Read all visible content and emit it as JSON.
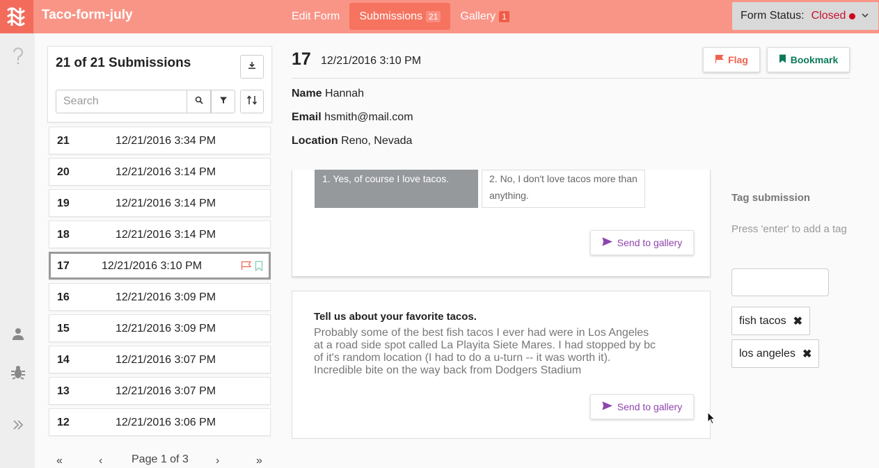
{
  "app": {
    "title": "Taco-form-july"
  },
  "nav": [
    {
      "label": "Edit Form",
      "badge": ""
    },
    {
      "label": "Submissions",
      "badge": "21"
    },
    {
      "label": "Gallery",
      "badge": "1"
    }
  ],
  "status": {
    "label": "Form Status:",
    "value": "Closed"
  },
  "submissions": {
    "title": "21 of 21 Submissions",
    "search_placeholder": "Search",
    "rows": [
      {
        "num": "21",
        "date": "12/21/2016 3:34 PM"
      },
      {
        "num": "20",
        "date": "12/21/2016 3:14 PM"
      },
      {
        "num": "19",
        "date": "12/21/2016 3:14 PM"
      },
      {
        "num": "18",
        "date": "12/21/2016 3:14 PM"
      },
      {
        "num": "17",
        "date": "12/21/2016 3:10 PM"
      },
      {
        "num": "16",
        "date": "12/21/2016 3:09 PM"
      },
      {
        "num": "15",
        "date": "12/21/2016 3:09 PM"
      },
      {
        "num": "14",
        "date": "12/21/2016 3:07 PM"
      },
      {
        "num": "13",
        "date": "12/21/2016 3:07 PM"
      },
      {
        "num": "12",
        "date": "12/21/2016 3:06 PM"
      }
    ],
    "pager": {
      "first": "«",
      "prev": "‹",
      "label": "Page 1 of 3",
      "next": "›",
      "last": "»"
    }
  },
  "detail": {
    "num": "17",
    "date": "12/21/2016 3:10 PM",
    "flag_label": "Flag",
    "bookmark_label": "Bookmark",
    "fields": [
      {
        "label": "Name",
        "value": "Hannah"
      },
      {
        "label": "Email",
        "value": "hsmith@mail.com"
      },
      {
        "label": "Location",
        "value": "Reno, Nevada"
      }
    ],
    "options": [
      "1. Yes, of course I love tacos.",
      "2. No, I don't love tacos more than anything."
    ],
    "send_label": "Send to gallery",
    "question": "Tell us about your favorite tacos.",
    "answer": "Probably some of the best fish tacos I ever had were in Los Angeles at a road side spot called La Playita Siete Mares. I had stopped by bc of it's random location (I had to do a u-turn -- it was worth it). Incredible bite on the way back from Dodgers Stadium"
  },
  "tags": {
    "title": "Tag submission",
    "hint": "Press 'enter' to add a tag",
    "items": [
      "fish tacos",
      "los angeles"
    ],
    "remove_glyph": "✖"
  },
  "colors": {
    "topbar": "#f99587",
    "accent": "#f6735f",
    "closed": "#c8102e",
    "bookmark": "#0b7a5b",
    "send": "#8e44ad"
  }
}
